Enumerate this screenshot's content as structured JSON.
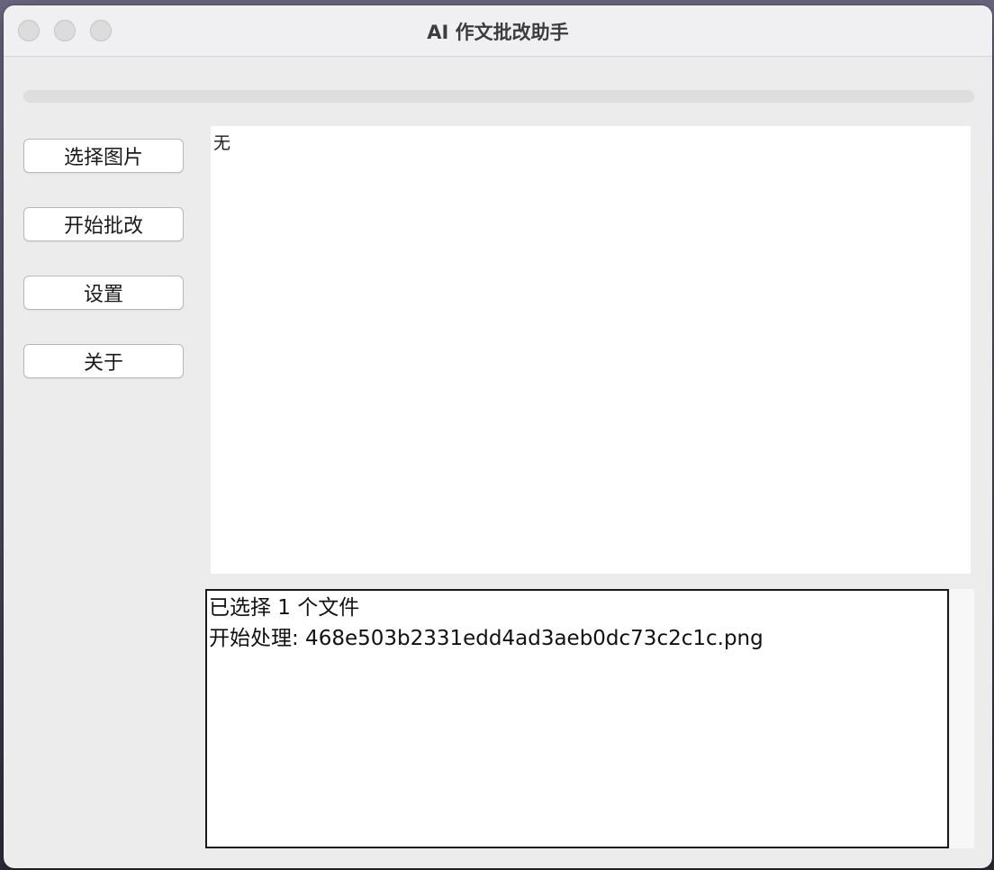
{
  "window": {
    "title": "AI 作文批改助手"
  },
  "progress": {
    "value_percent": 0
  },
  "sidebar": {
    "buttons": [
      {
        "label": "选择图片"
      },
      {
        "label": "开始批改"
      },
      {
        "label": "设置"
      },
      {
        "label": "关于"
      }
    ]
  },
  "preview": {
    "text": "无"
  },
  "log": {
    "lines": [
      "已选择 1 个文件",
      "开始处理: 468e503b2331edd4ad3aeb0dc73c2c1c.png"
    ]
  },
  "colors": {
    "window_bg": "#ececec",
    "titlebar_bg": "#f0f0f2",
    "panel_bg": "#ffffff",
    "log_border": "#1a1a1a"
  }
}
